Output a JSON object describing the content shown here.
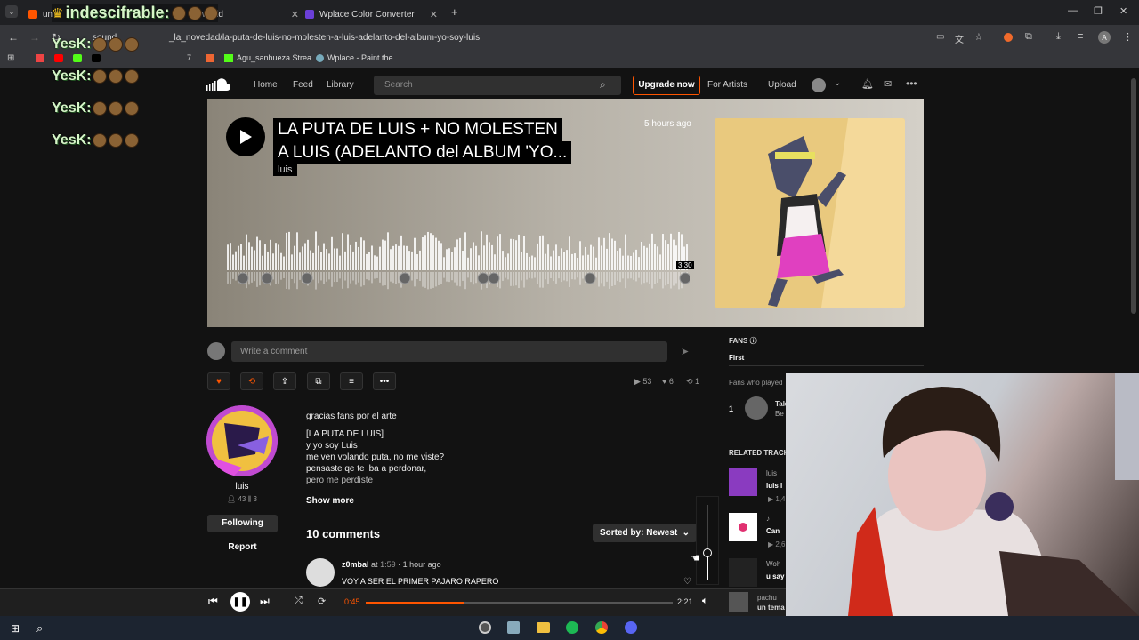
{
  "browser": {
    "tabs": [
      {
        "label": "un",
        "overlay": "indescifrable:",
        "suffix": "he world"
      },
      {
        "label": "Wplace Color Converter"
      }
    ],
    "url": "_la_novedad/la-puta-de-luis-no-molesten-a-luis-adelanto-del-album-yo-soy-luis",
    "url_prefix": "sound",
    "bookmarks": [
      "Agu_sanhueza Strea...",
      "Wplace - Paint the..."
    ],
    "profile_initial": "A"
  },
  "stream_overlay": {
    "emote_text": "YesK:",
    "crown_text": "indescifrable:"
  },
  "header": {
    "nav": [
      "Home",
      "Feed",
      "Library"
    ],
    "search_placeholder": "Search",
    "upgrade": "Upgrade now",
    "for_artists": "For Artists",
    "upload": "Upload"
  },
  "track": {
    "title_line1": "LA PUTA DE LUIS + NO MOLESTEN",
    "title_line2": "A LUIS (ADELANTO del ALBUM 'YO...",
    "artist": "luis",
    "posted": "5 hours ago",
    "duration": "3:30"
  },
  "comment_box": {
    "placeholder": "Write a comment"
  },
  "stats": {
    "plays": "53",
    "likes": "6",
    "reposts": "1"
  },
  "uploader": {
    "name": "luis",
    "followers": "43",
    "tracks": "3",
    "follow_label": "Following",
    "report_label": "Report"
  },
  "description": {
    "lines": [
      "gracias fans por el arte",
      "[LA PUTA DE LUIS]",
      "y yo soy Luis",
      "me ven volando puta, no me viste?",
      "pensaste qe te iba a perdonar,",
      "pero me perdiste"
    ],
    "show_more": "Show more"
  },
  "comments": {
    "count_label": "10 comments",
    "sort_label": "Sorted by: Newest",
    "items": [
      {
        "user": "z0mbal",
        "at": "at",
        "time": "1:59",
        "ago": "· 1 hour ago",
        "text": "VOY A SER EL PRIMER PAJARO RAPERO"
      }
    ]
  },
  "sidebar": {
    "fans_title": "FANS",
    "fans_tab": "First",
    "fans_sub": "Fans who played",
    "fan_rank": "1",
    "fan_name": "Tak",
    "fan_sub": "Be",
    "related_title": "RELATED TRACK",
    "related": [
      {
        "artist": "luis",
        "title": "luis l",
        "plays": "1,4"
      },
      {
        "artist": "♪",
        "title": "Can",
        "plays": "2,6"
      },
      {
        "artist": "Woh",
        "title": "u say",
        "plays": ""
      }
    ]
  },
  "player": {
    "elapsed": "0:45",
    "total": "2:21",
    "progress_fraction": 0.32,
    "now_artist": "pachu",
    "now_title": "un tema"
  },
  "colors": {
    "accent": "#ff5500",
    "background": "#121212"
  }
}
